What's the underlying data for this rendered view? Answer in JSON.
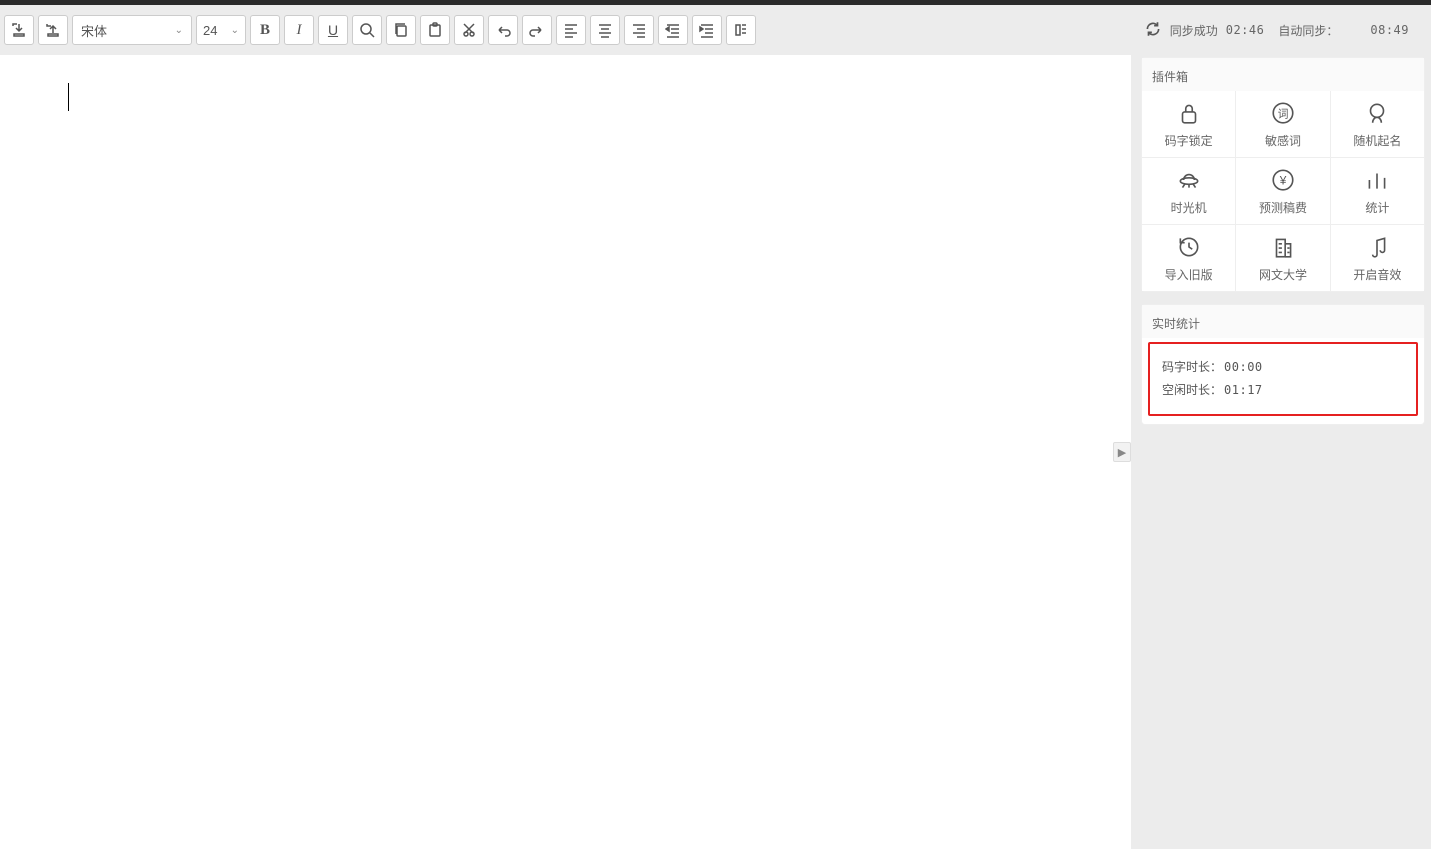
{
  "toolbar": {
    "font_name": "宋体",
    "font_size": "24"
  },
  "sync": {
    "status_label": "同步成功",
    "status_time": "02:46",
    "auto_label": "自动同步：",
    "auto_time": "08:49"
  },
  "sidebar": {
    "plugin_title": "插件箱",
    "plugins": [
      {
        "label": "码字锁定",
        "icon": "lock"
      },
      {
        "label": "敏感词",
        "icon": "word"
      },
      {
        "label": "随机起名",
        "icon": "head"
      },
      {
        "label": "时光机",
        "icon": "ufo"
      },
      {
        "label": "预测稿费",
        "icon": "yen"
      },
      {
        "label": "统计",
        "icon": "bars"
      },
      {
        "label": "导入旧版",
        "icon": "history"
      },
      {
        "label": "网文大学",
        "icon": "building"
      },
      {
        "label": "开启音效",
        "icon": "music"
      }
    ],
    "stats_title": "实时统计",
    "stats": {
      "typing_label": "码字时长：",
      "typing_value": "00:00",
      "idle_label": "空闲时长：",
      "idle_value": "01:17"
    }
  }
}
